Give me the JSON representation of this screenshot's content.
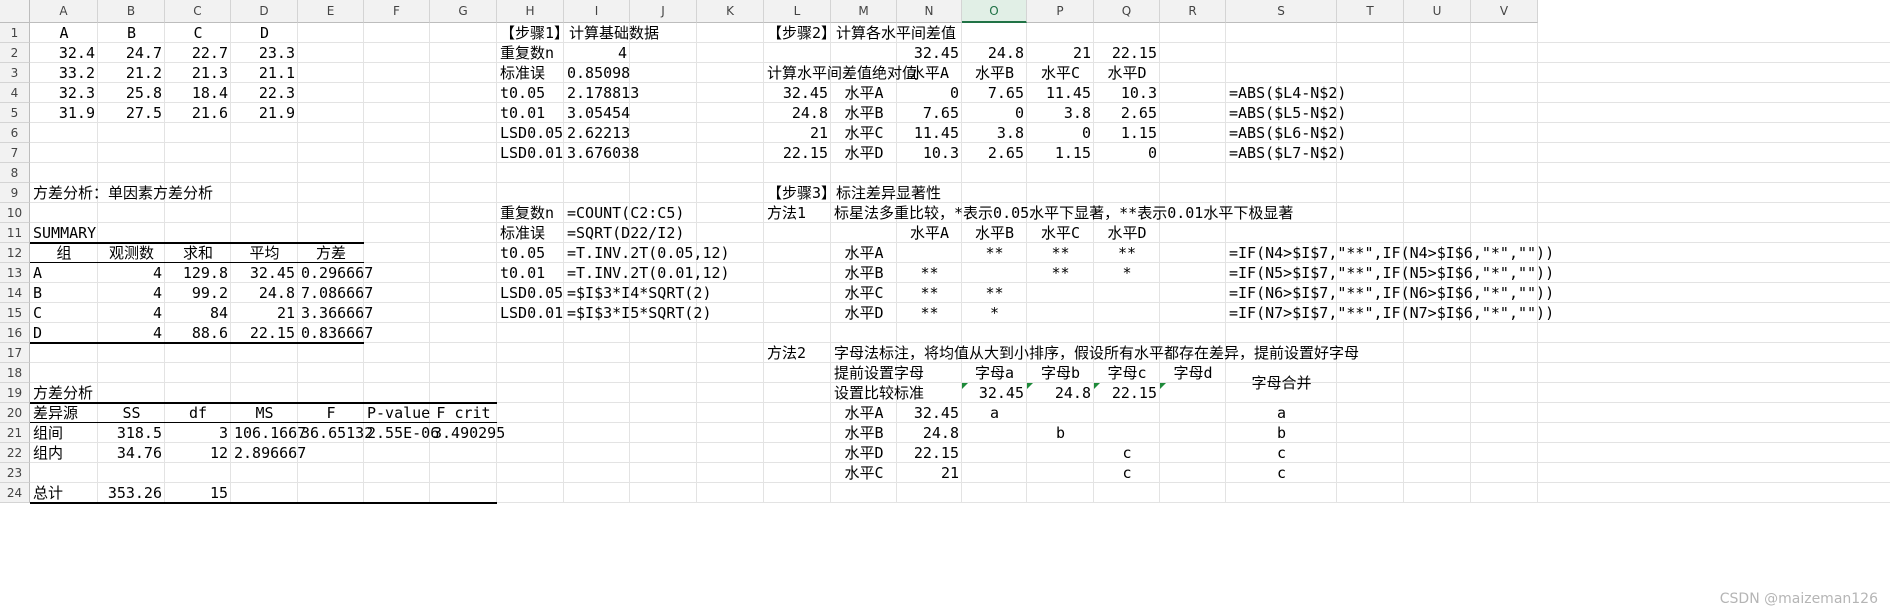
{
  "columns": [
    "A",
    "B",
    "C",
    "D",
    "E",
    "F",
    "G",
    "H",
    "I",
    "J",
    "K",
    "L",
    "M",
    "N",
    "O",
    "P",
    "Q",
    "R",
    "S",
    "T",
    "U",
    "V"
  ],
  "active_column": "O",
  "rows": [
    "1",
    "2",
    "3",
    "4",
    "5",
    "6",
    "7",
    "8",
    "9",
    "10",
    "11",
    "12",
    "13",
    "14",
    "15",
    "16",
    "17",
    "18",
    "19",
    "20",
    "21",
    "22",
    "23",
    "24"
  ],
  "cells": {
    "A1": "A",
    "B1": "B",
    "C1": "C",
    "D1": "D",
    "A2": "32.4",
    "B2": "24.7",
    "C2": "22.7",
    "D2": "23.3",
    "A3": "33.2",
    "B3": "21.2",
    "C3": "21.3",
    "D3": "21.1",
    "A4": "32.3",
    "B4": "25.8",
    "C4": "18.4",
    "D4": "22.3",
    "A5": "31.9",
    "B5": "27.5",
    "C5": "21.6",
    "D5": "21.9",
    "A9": "方差分析：单因素方差分析",
    "A11": "SUMMARY",
    "A12": "组",
    "B12": "观测数",
    "C12": "求和",
    "D12": "平均",
    "E12": "方差",
    "A13": "A",
    "B13": "4",
    "C13": "129.8",
    "D13": "32.45",
    "E13": "0.296667",
    "A14": "B",
    "B14": "4",
    "C14": "99.2",
    "D14": "24.8",
    "E14": "7.086667",
    "A15": "C",
    "B15": "4",
    "C15": "84",
    "D15": "21",
    "E15": "3.366667",
    "A16": "D",
    "B16": "4",
    "C16": "88.6",
    "D16": "22.15",
    "E16": "0.836667",
    "A19": "方差分析",
    "A20": "差异源",
    "B20": "SS",
    "C20": "df",
    "D20": "MS",
    "E20": "F",
    "F20": "P-value",
    "G20": "F crit",
    "A21": "组间",
    "B21": "318.5",
    "C21": "3",
    "D21": "106.1667",
    "E21": "36.65132",
    "F21": "2.55E-06",
    "G21": "3.490295",
    "A22": "组内",
    "B22": "34.76",
    "C22": "12",
    "D22": "2.896667",
    "A24": "总计",
    "B24": "353.26",
    "C24": "15",
    "H1": "【步骤1】计算基础数据",
    "H2": "重复数n",
    "I2": "4",
    "H3": "标准误",
    "I3": "0.85098",
    "H4": "t0.05",
    "I4": "2.178813",
    "H5": "t0.01",
    "I5": "3.05454",
    "H6": "LSD0.05",
    "I6": "2.62213",
    "H7": "LSD0.01",
    "I7": "3.676038",
    "H10": "重复数n",
    "I10": "=COUNT(C2:C5)",
    "H11": "标准误",
    "I11": "=SQRT(D22/I2)",
    "H12": "t0.05",
    "I12": "=T.INV.2T(0.05,12)",
    "H13": "t0.01",
    "I13": "=T.INV.2T(0.01,12)",
    "H14": "LSD0.05",
    "I14": "=$I$3*I4*SQRT(2)",
    "H15": "LSD0.01",
    "I15": "=$I$3*I5*SQRT(2)",
    "L1": "【步骤2】计算各水平间差值",
    "N2": "32.45",
    "O2": "24.8",
    "P2": "21",
    "Q2": "22.15",
    "L3": "计算水平间差值绝对值",
    "N3": "水平A",
    "O3": "水平B",
    "P3": "水平C",
    "Q3": "水平D",
    "L4": "32.45",
    "M4": "水平A",
    "N4": "0",
    "O4": "7.65",
    "P4": "11.45",
    "Q4": "10.3",
    "S4": "=ABS($L4-N$2)",
    "L5": "24.8",
    "M5": "水平B",
    "N5": "7.65",
    "O5": "0",
    "P5": "3.8",
    "Q5": "2.65",
    "S5": "=ABS($L5-N$2)",
    "L6": "21",
    "M6": "水平C",
    "N6": "11.45",
    "O6": "3.8",
    "P6": "0",
    "Q6": "1.15",
    "S6": "=ABS($L6-N$2)",
    "L7": "22.15",
    "M7": "水平D",
    "N7": "10.3",
    "O7": "2.65",
    "P7": "1.15",
    "Q7": "0",
    "S7": "=ABS($L7-N$2)",
    "L9": "【步骤3】标注差异显著性",
    "L10": "方法1",
    "M10": "标星法多重比较，*表示0.05水平下显著，**表示0.01水平下极显著",
    "N11": "水平A",
    "O11": "水平B",
    "P11": "水平C",
    "Q11": "水平D",
    "M12": "水平A",
    "O12": "**",
    "P12": "**",
    "Q12": "**",
    "S12": "=IF(N4>$I$7,\"**\",IF(N4>$I$6,\"*\",\"\"))",
    "M13": "水平B",
    "N13": "**",
    "P13": "**",
    "Q13": "*",
    "S13": "=IF(N5>$I$7,\"**\",IF(N5>$I$6,\"*\",\"\"))",
    "M14": "水平C",
    "N14": "**",
    "O14": "**",
    "S14": "=IF(N6>$I$7,\"**\",IF(N6>$I$6,\"*\",\"\"))",
    "M15": "水平D",
    "N15": "**",
    "O15": "*",
    "S15": "=IF(N7>$I$7,\"**\",IF(N7>$I$6,\"*\",\"\"))",
    "L17": "方法2",
    "M17": "字母法标注，将均值从大到小排序，假设所有水平都存在差异，提前设置好字母",
    "M18": "提前设置字母",
    "O18": "字母a",
    "P18": "字母b",
    "Q18": "字母c",
    "R18": "字母d",
    "S18": "字母合并",
    "M19": "设置比较标准",
    "O19": "32.45",
    "P19": "24.8",
    "Q19": "22.15",
    "M20": "水平A",
    "N20": "32.45",
    "O20": "a",
    "S20": "a",
    "M21": "水平B",
    "N21": "24.8",
    "P21": "b",
    "S21": "b",
    "M22": "水平D",
    "N22": "22.15",
    "Q22": "c",
    "S22": "c",
    "M23": "水平C",
    "N23": "21",
    "Q23": "c",
    "S23": "c"
  },
  "watermark": "CSDN @maizeman126"
}
